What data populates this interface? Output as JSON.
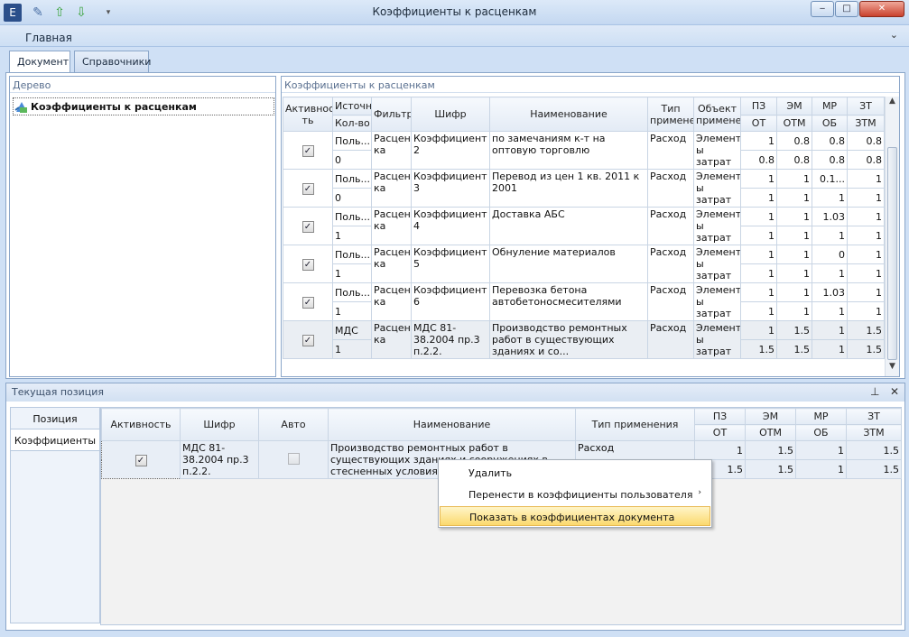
{
  "window": {
    "title": "Коэффициенты к расценкам",
    "min": "‒",
    "max": "□",
    "close": "✕"
  },
  "ribbon": {
    "tab": "Главная",
    "collapse_icon": "chevron-down"
  },
  "doc_tabs": [
    "Документ",
    "Справочники"
  ],
  "tree_panel": {
    "header": "Дерево",
    "item": "Коэффициенты к расценкам"
  },
  "coef_panel": {
    "header": "Коэффициенты к расценкам",
    "columns": {
      "active": "Активнос ть",
      "source": "Источни",
      "qty": "Кол-во",
      "filter": "Фильтр",
      "code": "Шифр",
      "name": "Наименование",
      "type": "Тип примене",
      "object": "Объект примене",
      "pz": "ПЗ",
      "em": "ЭМ",
      "mr": "МР",
      "zt": "ЗТ",
      "ot": "ОТ",
      "otm": "ОТМ",
      "ob": "ОБ",
      "ztm": "ЗТМ"
    },
    "rows": [
      {
        "active": true,
        "source": "Поль...",
        "qty": "0",
        "filter": "Расцен ка",
        "code": "Коэффициент 2",
        "name": "по замечаниям к-т на оптовую торговлю",
        "type": "Расход",
        "object": "Элемент ы затрат",
        "pz": "1",
        "em": "0.8",
        "mr": "0.8",
        "zt": "0.8",
        "ot": "0.8",
        "otm": "0.8",
        "ob": "0.8",
        "ztm": "0.8"
      },
      {
        "active": true,
        "source": "Поль...",
        "qty": "0",
        "filter": "Расцен ка",
        "code": "Коэффициент 3",
        "name": "Перевод из цен 1 кв. 2011 к 2001",
        "type": "Расход",
        "object": "Элемент ы затрат",
        "pz": "1",
        "em": "1",
        "mr": "0.1...",
        "zt": "1",
        "ot": "1",
        "otm": "1",
        "ob": "1",
        "ztm": "1"
      },
      {
        "active": true,
        "source": "Поль...",
        "qty": "1",
        "filter": "Расцен ка",
        "code": "Коэффициент 4",
        "name": "Доставка АБС",
        "type": "Расход",
        "object": "Элемент ы затрат",
        "pz": "1",
        "em": "1",
        "mr": "1.03",
        "zt": "1",
        "ot": "1",
        "otm": "1",
        "ob": "1",
        "ztm": "1"
      },
      {
        "active": true,
        "source": "Поль...",
        "qty": "1",
        "filter": "Расцен ка",
        "code": "Коэффициент 5",
        "name": "Обнуление материалов",
        "type": "Расход",
        "object": "Элемент ы затрат",
        "pz": "1",
        "em": "1",
        "mr": "0",
        "zt": "1",
        "ot": "1",
        "otm": "1",
        "ob": "1",
        "ztm": "1"
      },
      {
        "active": true,
        "source": "Поль...",
        "qty": "1",
        "filter": "Расцен ка",
        "code": "Коэффициент 6",
        "name": "Перевозка бетона автобетоносмесителями",
        "type": "Расход",
        "object": "Элемент ы затрат",
        "pz": "1",
        "em": "1",
        "mr": "1.03",
        "zt": "1",
        "ot": "1",
        "otm": "1",
        "ob": "1",
        "ztm": "1"
      },
      {
        "active": true,
        "source": "МДС",
        "qty": "1",
        "filter": "Расцен ка",
        "code": "МДС 81-38.2004 пр.3 п.2.2.",
        "name": "Производство ремонтных работ в существующих зданиях и со...",
        "type": "Расход",
        "object": "Элемент ы затрат",
        "pz": "1",
        "em": "1.5",
        "mr": "1",
        "zt": "1.5",
        "ot": "1.5",
        "otm": "1.5",
        "ob": "1",
        "ztm": "1.5"
      }
    ]
  },
  "current": {
    "header": "Текущая позиция",
    "pin_icon": "⊥",
    "close_icon": "✕",
    "tabs": [
      "Позиция",
      "Коэффициенты"
    ],
    "columns": {
      "active": "Активность",
      "code": "Шифр",
      "auto": "Авто",
      "name": "Наименование",
      "type": "Тип применения",
      "pz": "ПЗ",
      "em": "ЭМ",
      "mr": "МР",
      "zt": "ЗТ",
      "ot": "ОТ",
      "otm": "ОТМ",
      "ob": "ОБ",
      "ztm": "ЗТМ"
    },
    "row": {
      "active": true,
      "code": "МДС 81-38.2004 пр.3 п.2.2.",
      "auto": false,
      "name": "Производство ремонтных работ в существующих зданиях и сооружениях в стесненных условиях, с",
      "type": "Расход",
      "pz": "1",
      "em": "1.5",
      "mr": "1",
      "zt": "1.5",
      "ot": "1.5",
      "otm": "1.5",
      "ob": "1",
      "ztm": "1.5"
    }
  },
  "context_menu": {
    "items": [
      "Удалить",
      "Перенести в коэффициенты пользователя",
      "Показать в коэффициентах документа"
    ],
    "submenu_arrow": "›"
  }
}
